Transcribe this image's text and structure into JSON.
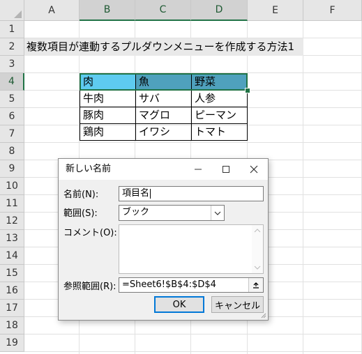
{
  "columns": [
    "A",
    "B",
    "C",
    "D",
    "E",
    "F"
  ],
  "rows": [
    "1",
    "2",
    "3",
    "4",
    "5",
    "6",
    "7",
    "8",
    "9",
    "10",
    "11",
    "12",
    "13",
    "14",
    "15",
    "16",
    "17",
    "18",
    "19"
  ],
  "sheet": {
    "title": "複数項目が連動するプルダウンメニューを作成する方法1",
    "table": [
      [
        "肉",
        "魚",
        "野菜"
      ],
      [
        "牛肉",
        "サバ",
        "人参"
      ],
      [
        "豚肉",
        "マグロ",
        "ピーマン"
      ],
      [
        "鶏肉",
        "イワシ",
        "トマト"
      ]
    ]
  },
  "colors": {
    "header_fill_b": "#5ecbf0",
    "header_fill_cd": "#4fa1bd",
    "selection": "#217346"
  },
  "dialog": {
    "title": "新しい名前",
    "name_label": "名前(N):",
    "name_value": "項目名",
    "scope_label": "範囲(S):",
    "scope_value": "ブック",
    "comment_label": "コメント(O):",
    "comment_value": "",
    "refers_label": "参照範囲(R):",
    "refers_value": "=Sheet6!$B$4:$D$4",
    "ok_label": "OK",
    "cancel_label": "キャンセル",
    "icons": {
      "minimize": "minimize-icon",
      "maximize": "maximize-icon",
      "close": "close-icon",
      "dropdown": "chevron-down-icon",
      "collapse": "collapse-dialog-icon"
    }
  }
}
